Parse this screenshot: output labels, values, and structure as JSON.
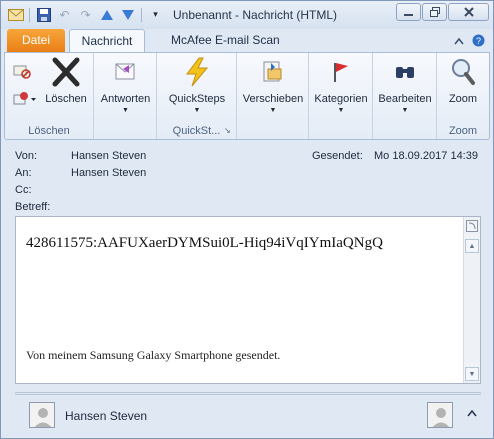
{
  "window": {
    "title": "Unbenannt  -  Nachricht (HTML)",
    "controls": [
      "minimize",
      "restore",
      "close"
    ]
  },
  "qat": {
    "icons": [
      "mail-icon",
      "save-icon",
      "undo-icon",
      "redo-icon",
      "up-arrow-icon",
      "down-arrow-icon",
      "customize-icon"
    ]
  },
  "tabs": {
    "file": "Datei",
    "message": "Nachricht",
    "mcafee": "McAfee E-mail Scan"
  },
  "ribbon": {
    "delete": {
      "label": "Löschen",
      "group": "Löschen"
    },
    "reply": {
      "label": "Antworten"
    },
    "quicksteps": {
      "label": "QuickSteps",
      "group": "QuickSt..."
    },
    "move": {
      "label": "Verschieben"
    },
    "tags": {
      "label": "Kategorien"
    },
    "editing": {
      "label": "Bearbeiten"
    },
    "zoom": {
      "label": "Zoom",
      "group": "Zoom"
    }
  },
  "headers": {
    "from_label": "Von:",
    "from_value": "Hansen Steven",
    "to_label": "An:",
    "to_value": "Hansen Steven",
    "cc_label": "Cc:",
    "subject_label": "Betreff:",
    "sent_label": "Gesendet:",
    "sent_value": "Mo 18.09.2017 14:39"
  },
  "body": {
    "line1": "428611575:AAFUXaerDYMSui0L-Hiq94iVqIYmIaQNgQ",
    "signature": "Von meinem Samsung Galaxy Smartphone gesendet."
  },
  "people": {
    "name": "Hansen Steven"
  },
  "colors": {
    "file_tab": "#ea7d14",
    "ribbon_bg": "#e4ecf6",
    "window_bg": "#dfe8f3"
  }
}
